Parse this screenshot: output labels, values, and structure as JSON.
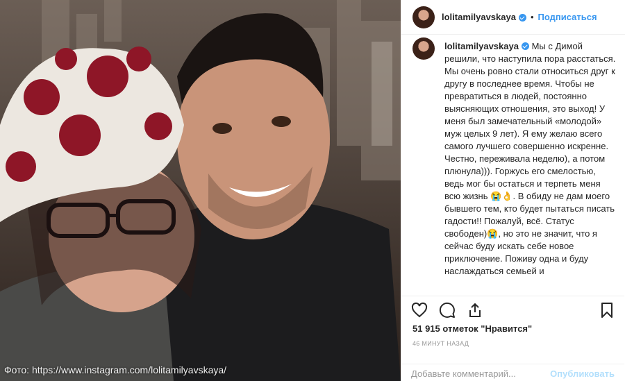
{
  "photo": {
    "credit": "Фото: https://www.instagram.com/lolitamilyavskaya/"
  },
  "header": {
    "username": "lolitamilyavskaya",
    "separator": "•",
    "follow_label": "Подписаться",
    "verified_icon": "verified-badge-icon"
  },
  "comment": {
    "username": "lolitamilyavskaya",
    "text": "Мы с Димой решили, что наступила пора расстаться. Мы очень ровно стали относиться друг к другу в последнее время. Чтобы не превратиться в людей, постоянно выясняющих отношения, это выход! У меня был замечательный «молодой» муж целых 9 лет). Я ему желаю всего самого лучшего совершенно искренне. Честно, переживала неделю), а потом плюнула))). Горжусь его смелостью, ведь мог бы остаться и терпеть меня всю жизнь 😭👌. В обиду не дам моего бывшего тем, кто будет пытаться писать гадости!! Пожалуй, всё. Статус свободен)😭, но это не значит, что я сейчас буду искать себе новое приключение. Поживу одна и буду наслаждаться семьей и"
  },
  "actions": {
    "icons": [
      "heart-icon",
      "comment-icon",
      "share-icon",
      "bookmark-icon"
    ]
  },
  "likes": "51 915 отметок \"Нравится\"",
  "time": "46 минут назад",
  "add_comment": {
    "placeholder": "Добавьте комментарий...",
    "publish_label": "Опубликовать"
  },
  "colors": {
    "accent": "#3897f0",
    "muted": "#999999",
    "publish_disabled": "#b2dffc"
  }
}
